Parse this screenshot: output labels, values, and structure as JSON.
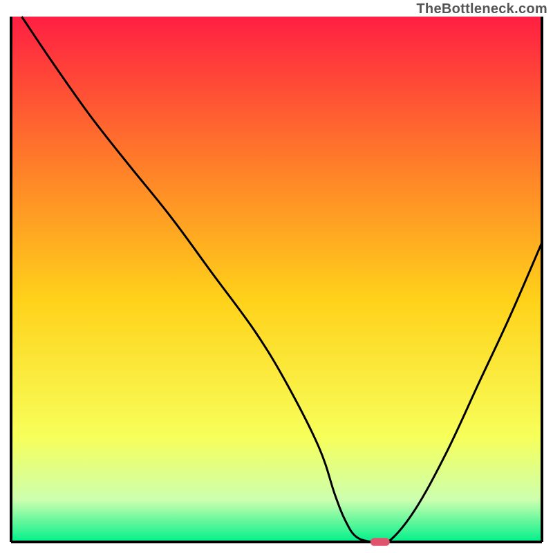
{
  "attribution": "TheBottleneck.com",
  "colors": {
    "top": "#ff1f42",
    "q1": "#ff7a2a",
    "mid": "#ffd21a",
    "q3": "#f7ff5a",
    "low": "#ccffaf",
    "bottom": "#00f08a",
    "border": "#000000",
    "curve": "#000000",
    "marker_fill": "#e0536e",
    "marker_stroke": "#e0536e"
  },
  "chart_data": {
    "type": "line",
    "title": "",
    "xlabel": "",
    "ylabel": "",
    "xlim": [
      0,
      100
    ],
    "ylim": [
      0,
      100
    ],
    "grid": false,
    "legend": false,
    "x": [
      2,
      8,
      15,
      22,
      30,
      38,
      46,
      52,
      58,
      61,
      63,
      65,
      68,
      71,
      76,
      82,
      88,
      94,
      100
    ],
    "values": [
      100,
      91,
      81,
      72,
      62,
      51,
      40,
      30,
      18,
      9,
      4,
      1,
      0,
      0,
      6,
      17,
      30,
      43,
      57
    ],
    "marker_x": 69.5,
    "marker_y": 0,
    "marker_w": 3.5,
    "marker_h": 1.4
  }
}
